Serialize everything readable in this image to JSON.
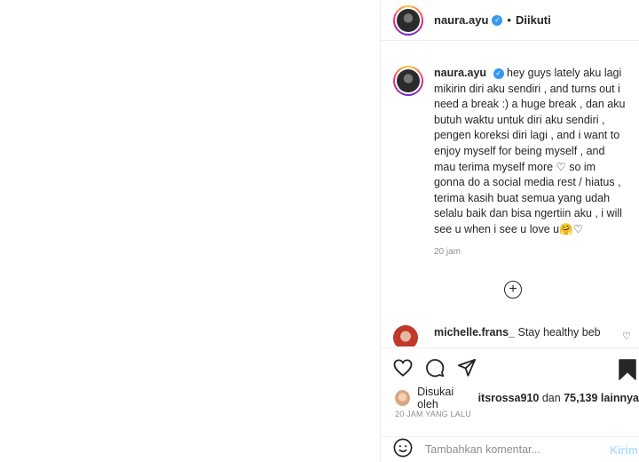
{
  "header": {
    "username": "naura.ayu",
    "follow_label": "Diikuti",
    "separator": "•"
  },
  "caption": {
    "username": "naura.ayu",
    "text": "hey guys lately aku lagi mikirin diri aku sendiri , and turns out i need a break :) a huge break , dan aku butuh waktu untuk diri aku sendiri , pengen koreksi diri lagi , and i want to enjoy myself for being myself , and mau terima myself more ♡ so im gonna do a social media rest / hiatus , terima kasih buat semua yang udah selalu baik dan bisa ngertiin aku , i will see u when i see u love u🤗♡",
    "time": "20 jam"
  },
  "comment": {
    "username": "michelle.frans_",
    "text": "Stay healthy beb"
  },
  "likes": {
    "prefix": "Disukai oleh",
    "liker": "itsrossa910",
    "middle": "dan",
    "count": "75,139",
    "suffix": "lainnya"
  },
  "timestamp": "20 JAM YANG LALU",
  "add_comment": {
    "placeholder": "Tambahkan komentar...",
    "send_label": "Kirim"
  },
  "icons": {
    "like": "heart-icon",
    "comment": "comment-icon",
    "share": "share-icon",
    "save": "bookmark-icon",
    "emoji": "emoji-icon",
    "load_more": "plus-circle-icon",
    "verified": "verified-badge-icon"
  },
  "colors": {
    "verified": "#3897f0",
    "muted": "#8e8e8e",
    "send": "#b2dffc"
  }
}
